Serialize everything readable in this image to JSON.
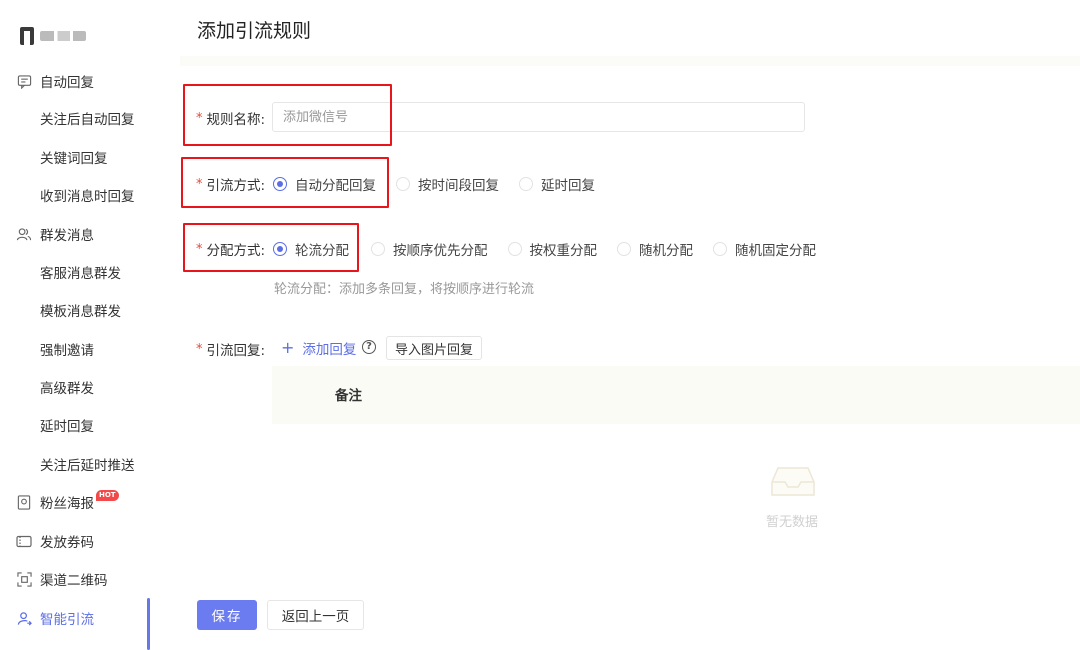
{
  "sidebar": {
    "items": [
      {
        "label": "自动回复",
        "icon": "message-icon",
        "type": "group"
      },
      {
        "label": "关注后自动回复",
        "type": "sub"
      },
      {
        "label": "关键词回复",
        "type": "sub"
      },
      {
        "label": "收到消息时回复",
        "type": "sub"
      },
      {
        "label": "群发消息",
        "icon": "users-icon",
        "type": "group"
      },
      {
        "label": "客服消息群发",
        "type": "sub"
      },
      {
        "label": "模板消息群发",
        "type": "sub"
      },
      {
        "label": "强制邀请",
        "type": "sub"
      },
      {
        "label": "高级群发",
        "type": "sub"
      },
      {
        "label": "延时回复",
        "type": "sub"
      },
      {
        "label": "关注后延时推送",
        "type": "sub"
      },
      {
        "label": "粉丝海报",
        "icon": "poster-icon",
        "type": "group",
        "badge": "HOT"
      },
      {
        "label": "发放券码",
        "icon": "ticket-icon",
        "type": "group"
      },
      {
        "label": "渠道二维码",
        "icon": "qrcode-icon",
        "type": "group"
      },
      {
        "label": "智能引流",
        "icon": "user-flow-icon",
        "type": "group",
        "active": true
      }
    ]
  },
  "page": {
    "title": "添加引流规则"
  },
  "form": {
    "rule_name": {
      "label": "规则名称:",
      "placeholder": "添加微信号"
    },
    "diversion_method": {
      "label": "引流方式:",
      "options": [
        "自动分配回复",
        "按时间段回复",
        "延时回复"
      ],
      "selected": "自动分配回复"
    },
    "distribution_method": {
      "label": "分配方式:",
      "options": [
        "轮流分配",
        "按顺序优先分配",
        "按权重分配",
        "随机分配",
        "随机固定分配"
      ],
      "selected": "轮流分配",
      "hint": "轮流分配：添加多条回复，将按顺序进行轮流"
    },
    "diversion_reply": {
      "label": "引流回复:",
      "add_label": "添加回复",
      "import_label": "导入图片回复",
      "table_header": "备注",
      "empty_text": "暂无数据"
    }
  },
  "actions": {
    "save_label": "保存",
    "back_label": "返回上一页"
  },
  "colors": {
    "accent": "#5b6ee6",
    "save_button": "#6b7cf0",
    "required_star": "#e8483b",
    "highlight_box": "#e8161b",
    "hot_badge": "#f24a4a"
  }
}
